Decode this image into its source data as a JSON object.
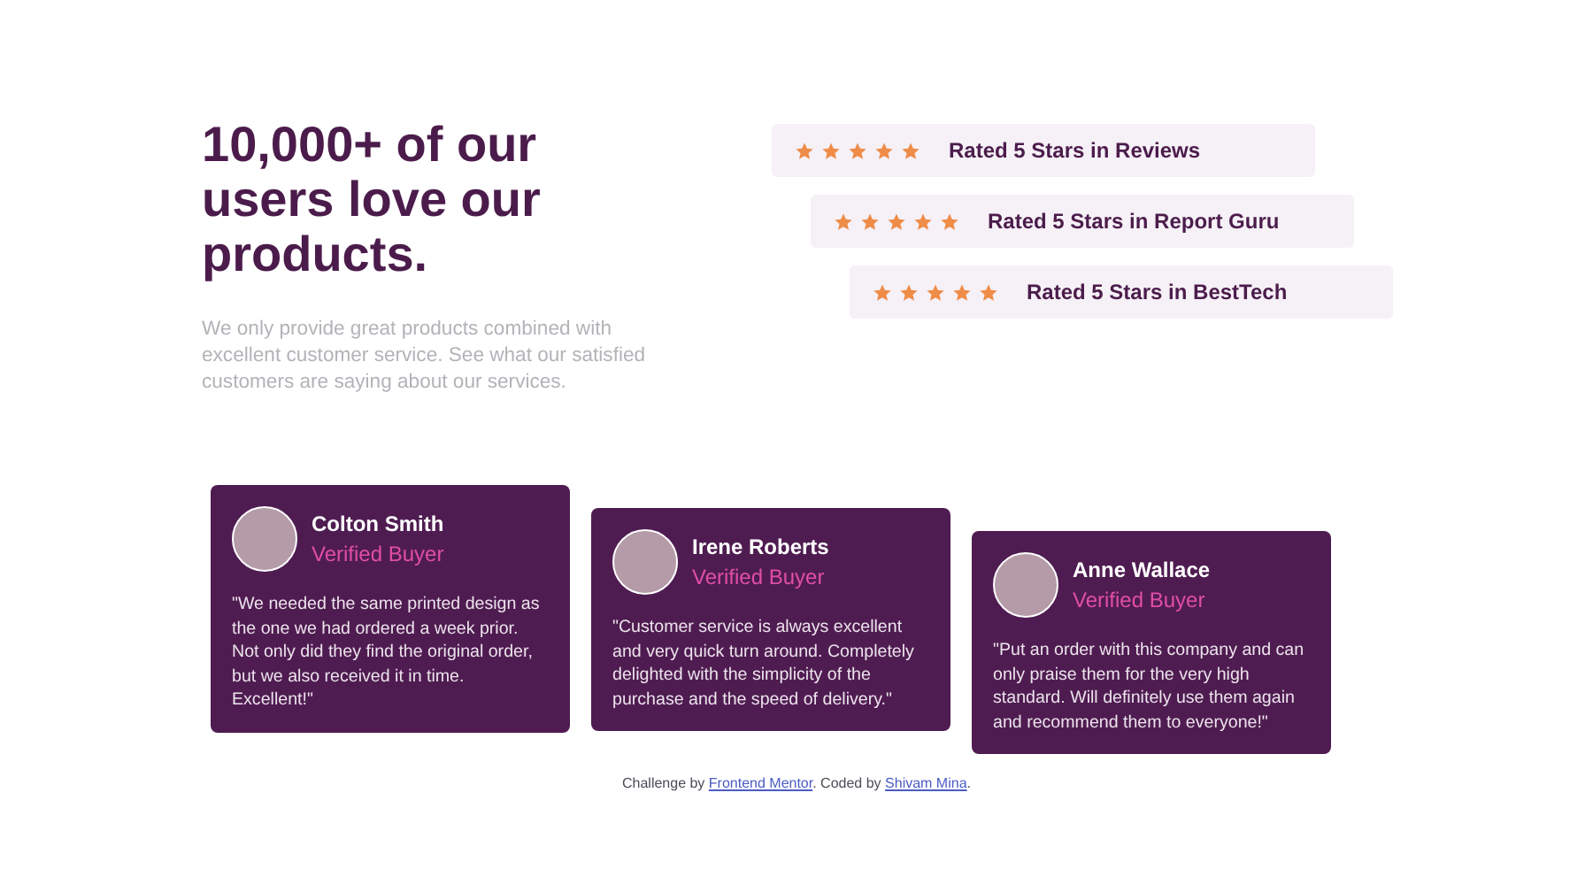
{
  "heading": "10,000+ of our users love our products.",
  "intro": "We only provide great products combined with excellent customer service. See what our satisfied customers are saying about our services.",
  "ratings": [
    {
      "stars": 5,
      "label": "Rated 5 Stars in Reviews"
    },
    {
      "stars": 5,
      "label": "Rated 5 Stars in Report Guru"
    },
    {
      "stars": 5,
      "label": "Rated 5 Stars in BestTech"
    }
  ],
  "testimonials": [
    {
      "name": "Colton Smith",
      "role": "Verified Buyer",
      "quote": "\"We needed the same printed design as the one we had ordered a week prior. Not only did they find the original order, but we also received it in time. Excellent!\""
    },
    {
      "name": "Irene Roberts",
      "role": "Verified Buyer",
      "quote": "\"Customer service is always excellent and very quick turn around. Completely delighted with the simplicity of the purchase and the speed of delivery.\""
    },
    {
      "name": "Anne Wallace",
      "role": "Verified Buyer",
      "quote": "\"Put an order with this company and can only praise them for the very high standard. Will definitely use them again and recommend them to everyone!\""
    }
  ],
  "footer": {
    "before": "Challenge by ",
    "link1": "Frontend Mentor",
    "middle": ". Coded by ",
    "link2": "Shivam Mina",
    "after": "."
  }
}
